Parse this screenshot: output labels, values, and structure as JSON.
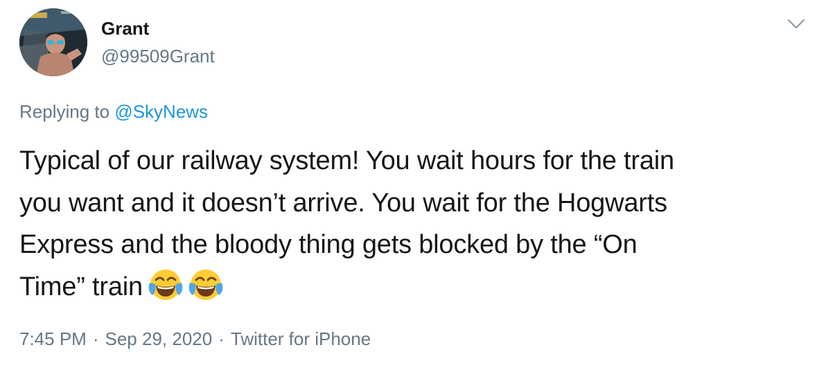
{
  "author": {
    "name": "Grant",
    "handle": "@99509Grant"
  },
  "reply": {
    "prefix": "Replying to ",
    "mention": "@SkyNews"
  },
  "tweet": {
    "lines": [
      "Typical of our railway system! You wait hours for the train",
      "you want and it doesn’t arrive. You wait for the Hogwarts",
      "Express and the bloody thing gets blocked by the “On",
      "Time” train"
    ],
    "emojis": [
      "face-with-tears-of-joy-icon",
      "face-with-tears-of-joy-icon"
    ]
  },
  "meta": {
    "time": "7:45 PM",
    "separator": "·",
    "date": "Sep 29, 2020",
    "source": "Twitter for iPhone"
  },
  "colors": {
    "text": "#14171a",
    "secondary": "#657786",
    "link": "#1b95e0"
  }
}
